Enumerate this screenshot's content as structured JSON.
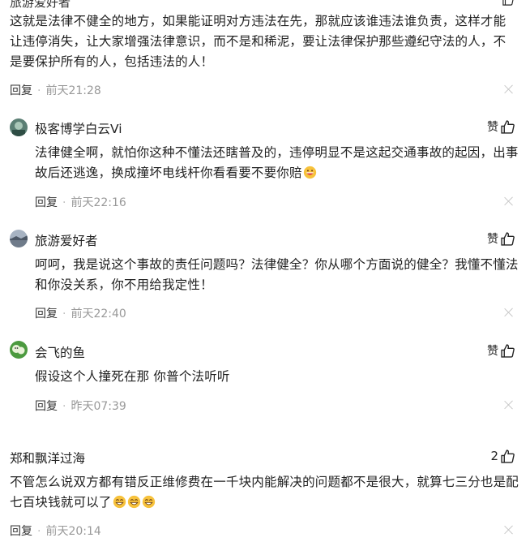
{
  "top_comment": {
    "username": "旅游爱好者",
    "text": "这就是法律不健全的地方，如果能证明对方违法在先，那就应该谁违法谁负责，这样才能让违停消失，让大家增强法律意识，而不是和稀泥，要让法律保护那些遵纪守法的人，不是要保护所有的人，包括违法的人！",
    "reply_label": "回复",
    "time": "前天21:28"
  },
  "replies": [
    {
      "username": "极客博学白云Vi",
      "like_label": "赞",
      "text": "法律健全啊，就怕你这种不懂法还瞎普及的，违停明显不是这起交通事故的起因，出事故后还逃逸，换成撞坏电线杆你看看要不要你赔",
      "emoji": "grinning-face-emoji",
      "reply_label": "回复",
      "time": "前天22:16"
    },
    {
      "username": "旅游爱好者",
      "like_label": "赞",
      "text": "呵呵，我是说这个事故的责任问题吗？法律健全？你从哪个方面说的健全？我懂不懂法和你没关系，你不用给我定性！",
      "reply_label": "回复",
      "time": "前天22:40"
    },
    {
      "username": "会飞的鱼",
      "like_label": "赞",
      "text": "假设这个人撞死在那 你普个法听听",
      "reply_label": "回复",
      "time": "昨天07:39"
    }
  ],
  "second_comment": {
    "username": "郑和飘洋过海",
    "like_count": "2",
    "text": "不管怎么说双方都有错反正维修费在一千块内能解决的问题都不是很大，就算七三分也是配七百块钱就可以了",
    "emojis": [
      "smiling-face-emoji",
      "smiling-face-emoji",
      "smiling-face-emoji"
    ],
    "reply_label": "回复",
    "time": "前天20:14"
  },
  "colors": {
    "text": "#222222",
    "time": "#999999",
    "close": "#c8c8c8"
  }
}
